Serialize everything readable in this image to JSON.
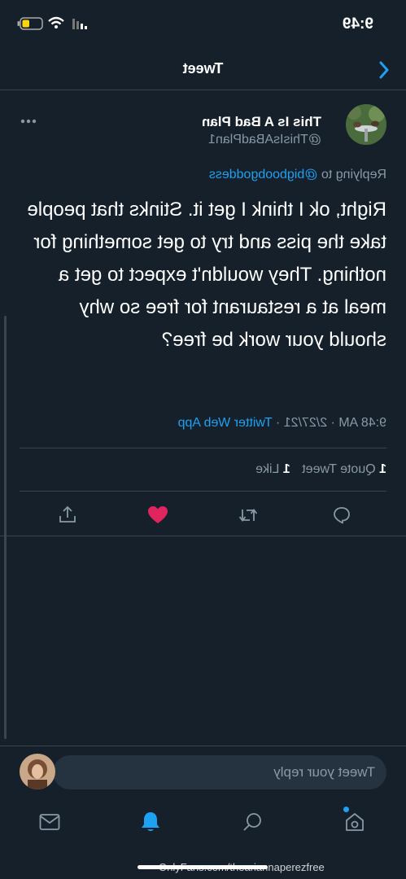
{
  "status_bar": {
    "time": "9:49"
  },
  "header": {
    "title": "Tweet"
  },
  "tweet": {
    "display_name": "This Is A Bad Plan",
    "handle": "@ThisIsABadPlan1",
    "replying_prefix": "Replying to",
    "replying_handle": "@bigboobgoddess",
    "text": "Right, ok I think I get it. Stinks that people take the piss and try to get something for nothing. They wouldn't expect to get a meal at a restaurant for free so why should your work be free?",
    "timestamp": "9:48 AM · 2/27/21 ·",
    "source": "Twitter Web App",
    "stats": {
      "quote_count": "1",
      "quote_label": "Quote Tweet",
      "like_count": "1",
      "like_label": "Like"
    }
  },
  "reply_box": {
    "placeholder": "Tweet your reply"
  },
  "watermark": "OnlyFans.com/theariannaperezfree",
  "colors": {
    "background": "#15202b",
    "accent": "#1da1f2",
    "like": "#e0245e",
    "muted": "#8899a6",
    "divider": "#38444d"
  },
  "icons": {
    "back": "chevron-icon",
    "more": "more-dots-icon",
    "reply": "reply-icon",
    "retweet": "retweet-icon",
    "like": "heart-filled-icon",
    "share": "share-icon",
    "tab_home": "home-icon",
    "tab_search": "search-icon",
    "tab_notifications": "bell-icon",
    "tab_messages": "mail-icon"
  }
}
